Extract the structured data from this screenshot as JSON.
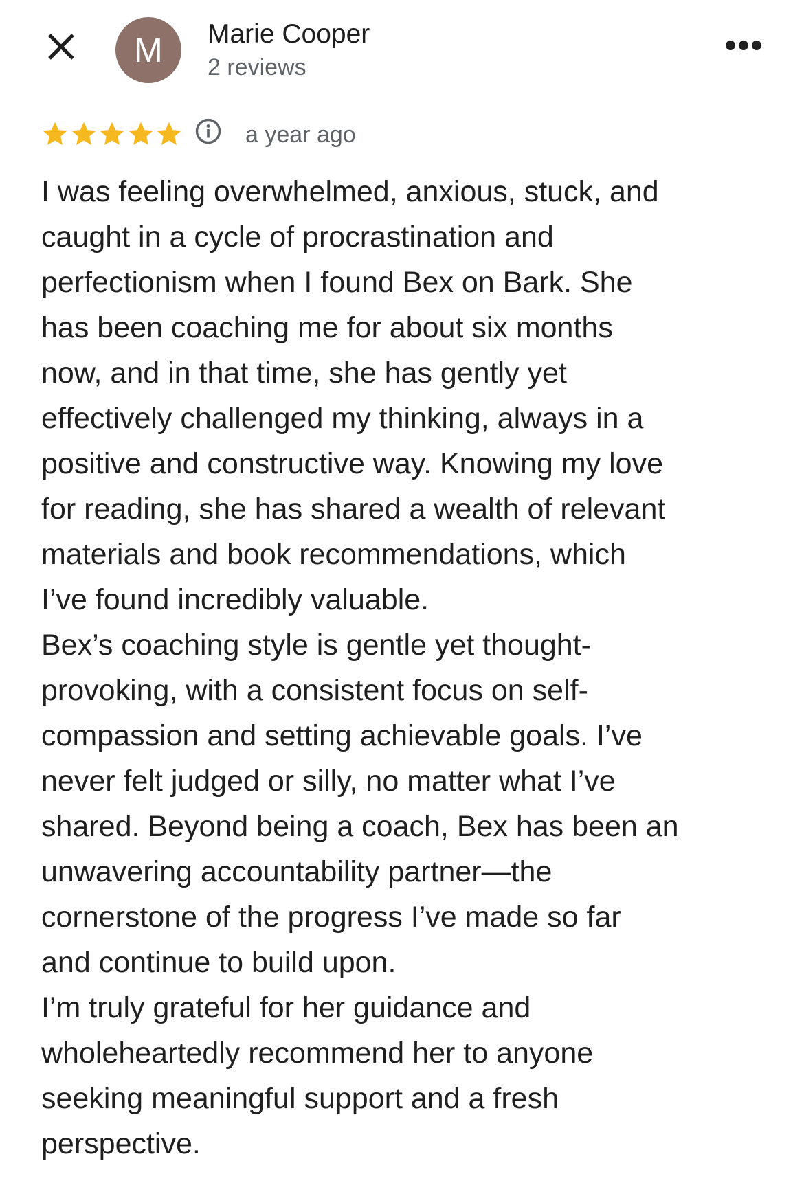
{
  "reviewer": {
    "avatar_initial": "M",
    "avatar_color": "#8e7168",
    "name": "Marie Cooper",
    "review_count": "2 reviews"
  },
  "icons": {
    "close": "close-icon",
    "more": "more-horizontal-icon",
    "star": "star-icon",
    "info": "info-icon"
  },
  "rating": {
    "stars": 5,
    "max_stars": 5,
    "star_color": "#f6b81f",
    "date": "a year ago"
  },
  "review": {
    "lines": [
      "I was feeling overwhelmed, anxious, stuck, and",
      "caught in a cycle of procrastination and",
      "perfectionism when I found Bex on Bark. She",
      "has been coaching me for about six months",
      "now, and in that time, she has gently yet",
      "effectively challenged my thinking, always in a",
      "positive and constructive way. Knowing my love",
      "for reading, she has shared a wealth of relevant",
      "materials and book recommendations, which",
      "I’ve found incredibly valuable.",
      "Bex’s coaching style is gentle yet thought-",
      "provoking, with a consistent focus on self-",
      "compassion and setting achievable goals. I’ve",
      "never felt judged or silly, no matter what I’ve",
      "shared. Beyond being a coach, Bex has been an",
      "unwavering accountability partner—the",
      "cornerstone of the progress I’ve made so far",
      "and continue to build upon.",
      "I’m truly grateful for her guidance and",
      "wholeheartedly recommend her to anyone",
      "seeking meaningful support and a fresh",
      "perspective."
    ]
  }
}
